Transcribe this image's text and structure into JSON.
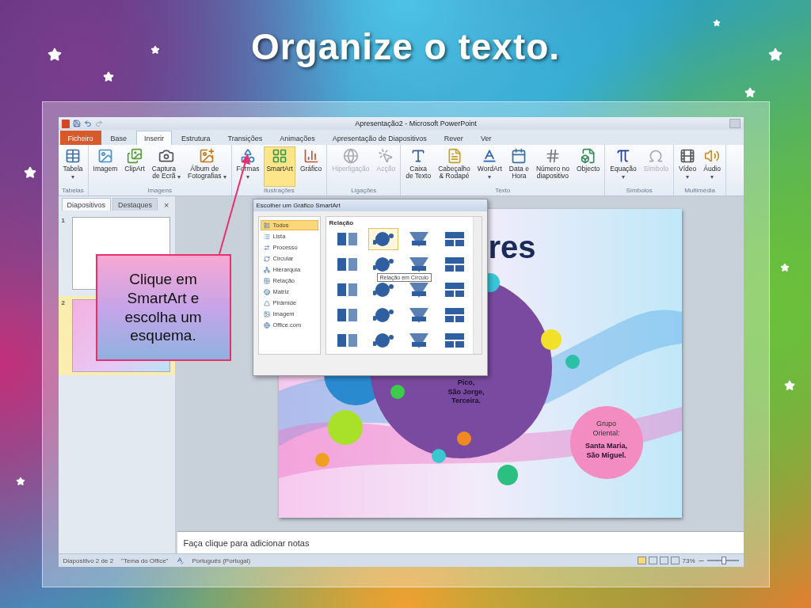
{
  "slide_title": "Organize o texto.",
  "window": {
    "title": "Apresentação2 - Microsoft PowerPoint"
  },
  "tabs": [
    {
      "label": "Ficheiro",
      "kind": "file",
      "selected": false
    },
    {
      "label": "Base",
      "kind": "tab",
      "selected": false
    },
    {
      "label": "Inserir",
      "kind": "tab",
      "selected": true
    },
    {
      "label": "Estrutura",
      "kind": "tab",
      "selected": false
    },
    {
      "label": "Transições",
      "kind": "tab",
      "selected": false
    },
    {
      "label": "Animações",
      "kind": "tab",
      "selected": false
    },
    {
      "label": "Apresentação de Diapositivos",
      "kind": "tab",
      "selected": false
    },
    {
      "label": "Rever",
      "kind": "tab",
      "selected": false
    },
    {
      "label": "Ver",
      "kind": "tab",
      "selected": false
    }
  ],
  "ribbon": [
    {
      "label": "Tabelas",
      "buttons": [
        {
          "label": "Tabela",
          "caret": "▾",
          "disabled": false,
          "highlighted": false
        }
      ]
    },
    {
      "label": "Imagens",
      "buttons": [
        {
          "label": "Imagem",
          "disabled": false,
          "highlighted": false
        },
        {
          "label": "ClipArt",
          "disabled": false,
          "highlighted": false
        },
        {
          "label": "Captura\nde Ecrã",
          "caret": "▾",
          "disabled": false,
          "highlighted": false
        },
        {
          "label": "Álbum de\nFotografias",
          "caret": "▾",
          "disabled": false,
          "highlighted": false
        }
      ]
    },
    {
      "label": "Ilustrações",
      "buttons": [
        {
          "label": "Formas",
          "caret": "▾",
          "disabled": false,
          "highlighted": false
        },
        {
          "label": "SmartArt",
          "disabled": false,
          "highlighted": true
        },
        {
          "label": "Gráfico",
          "disabled": false,
          "highlighted": false
        }
      ]
    },
    {
      "label": "Ligações",
      "buttons": [
        {
          "label": "Hiperligação",
          "disabled": true,
          "highlighted": false
        },
        {
          "label": "Acção",
          "disabled": true,
          "highlighted": false
        }
      ]
    },
    {
      "label": "Texto",
      "buttons": [
        {
          "label": "Caixa\nde Texto",
          "disabled": false,
          "highlighted": false
        },
        {
          "label": "Cabeçalho\n& Rodapé",
          "disabled": false,
          "highlighted": false
        },
        {
          "label": "WordArt",
          "caret": "▾",
          "disabled": false,
          "highlighted": false
        },
        {
          "label": "Data e\nHora",
          "disabled": false,
          "highlighted": false
        },
        {
          "label": "Número no\ndiapositivo",
          "disabled": false,
          "highlighted": false
        },
        {
          "label": "Objecto",
          "disabled": false,
          "highlighted": false
        }
      ]
    },
    {
      "label": "Símbolos",
      "buttons": [
        {
          "label": "Equação",
          "caret": "▾",
          "disabled": false,
          "highlighted": false
        },
        {
          "label": "Símbolo",
          "disabled": true,
          "highlighted": false
        }
      ]
    },
    {
      "label": "Multimédia",
      "buttons": [
        {
          "label": "Vídeo",
          "caret": "▾",
          "disabled": false,
          "highlighted": false
        },
        {
          "label": "Áudio",
          "caret": "▾",
          "disabled": false,
          "highlighted": false
        }
      ]
    }
  ],
  "side_panel": {
    "tabs": [
      {
        "label": "Diapositivos",
        "selected": true
      },
      {
        "label": "Destaques",
        "selected": false
      }
    ],
    "close": "×",
    "thumbnails": [
      {
        "number": "1",
        "selected": false
      },
      {
        "number": "2",
        "selected": true
      }
    ]
  },
  "callout": {
    "text": "Clique em SmartArt e escolha um esquema."
  },
  "dialog": {
    "title": "Escolher um Gráfico SmartArt",
    "categories": [
      {
        "label": "Todos",
        "selected": true
      },
      {
        "label": "Lista",
        "selected": false
      },
      {
        "label": "Processo",
        "selected": false
      },
      {
        "label": "Circular",
        "selected": false
      },
      {
        "label": "Hierarquia",
        "selected": false
      },
      {
        "label": "Relação",
        "selected": false
      },
      {
        "label": "Matriz",
        "selected": false
      },
      {
        "label": "Pirâmide",
        "selected": false
      },
      {
        "label": "Imagem",
        "selected": false
      },
      {
        "label": "Office.com",
        "selected": false
      }
    ],
    "heading": "Relação",
    "tooltip": "Relação em Círculo",
    "layouts": [
      {
        "selected": false
      },
      {
        "selected": true
      },
      {
        "selected": false
      },
      {
        "selected": false
      },
      {
        "selected": false
      },
      {
        "selected": false
      },
      {
        "selected": false
      },
      {
        "selected": false
      },
      {
        "selected": false
      },
      {
        "selected": false
      },
      {
        "selected": false
      },
      {
        "selected": false
      },
      {
        "selected": false
      },
      {
        "selected": false
      },
      {
        "selected": false
      },
      {
        "selected": false
      },
      {
        "selected": false
      },
      {
        "selected": false
      },
      {
        "selected": false
      },
      {
        "selected": false
      }
    ]
  },
  "slide": {
    "title": "res",
    "center_circle": "Pico,\nSão Jorge,\nTerceira.",
    "side_circle": {
      "label": "Grupo\nOriental:",
      "islands": "Santa Maria,\nSão Miguel."
    }
  },
  "notes": {
    "placeholder": "Faça clique para adicionar notas"
  },
  "status_bar": {
    "slide": "Diapositivo 2 de 2",
    "theme": "\"Tema do Office\"",
    "language": "Português (Portugal)",
    "zoom": "73%",
    "zoom_slider": {
      "level": 0.5
    }
  }
}
